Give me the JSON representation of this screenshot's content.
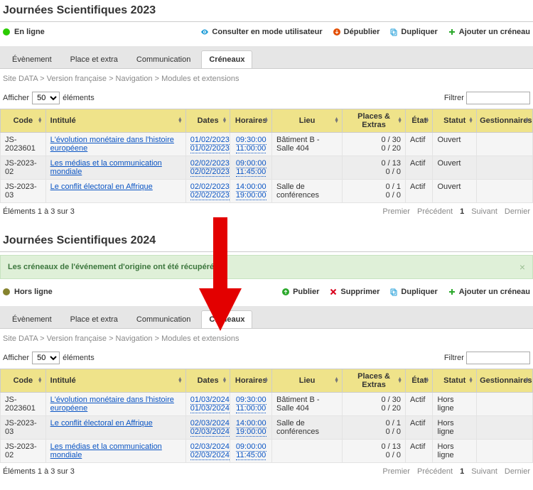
{
  "events": [
    {
      "title": "Journées Scientifiques 2023",
      "status": {
        "label": "En ligne",
        "online": true
      },
      "actions": [
        {
          "id": "view-mode",
          "label": "Consulter en mode utilisateur",
          "icon": "eye",
          "color": "#1f9dd8"
        },
        {
          "id": "unpublish",
          "label": "Dépublier",
          "icon": "arrowdown",
          "color": "#e34d00"
        },
        {
          "id": "duplicate",
          "label": "Dupliquer",
          "icon": "copy",
          "color": "#1f9dd8"
        },
        {
          "id": "add-slot",
          "label": "Ajouter un créneau",
          "icon": "plus",
          "color": "#2aa82a"
        }
      ],
      "notice": null,
      "tabs": [
        "Évènement",
        "Place et extra",
        "Communication",
        "Créneaux"
      ],
      "active_tab": 3,
      "breadcrumb": "Site DATA > Version française > Navigation > Modules et extensions",
      "display": {
        "prefix": "Afficher",
        "count": "50",
        "suffix": "éléments"
      },
      "filter_label": "Filtrer",
      "filter_value": "",
      "columns": [
        "Code",
        "Intitulé",
        "Dates",
        "Horaires",
        "Lieu",
        "Places & Extras",
        "État",
        "Statut",
        "Gestionnaires"
      ],
      "rows": [
        {
          "code": "JS-2023601",
          "title": "L'évolution monétaire dans l'histoire européene",
          "dates": [
            "01/02/2023",
            "01/02/2023"
          ],
          "times": [
            "09:30:00",
            "11:00:00"
          ],
          "lieu": "Bâtiment B - Salle 404",
          "pe": [
            "0 / 30",
            "0 / 20"
          ],
          "etat": "Actif",
          "statut": "Ouvert",
          "gest": ""
        },
        {
          "code": "JS-2023-02",
          "title": "Les médias et la communication mondiale",
          "dates": [
            "02/02/2023",
            "02/02/2023"
          ],
          "times": [
            "09:00:00",
            "11:45:00"
          ],
          "lieu": "",
          "pe": [
            "0 / 13",
            "0 / 0"
          ],
          "etat": "Actif",
          "statut": "Ouvert",
          "gest": ""
        },
        {
          "code": "JS-2023-03",
          "title": "Le conflit électoral en Affrique",
          "dates": [
            "02/02/2023",
            "02/02/2023"
          ],
          "times": [
            "14:00:00",
            "19:00:00"
          ],
          "lieu": "Salle de conférences",
          "pe": [
            "0 / 1",
            "0 / 0"
          ],
          "etat": "Actif",
          "statut": "Ouvert",
          "gest": ""
        }
      ],
      "footer_info": "Éléments 1 à 3 sur 3",
      "pager": [
        "Premier",
        "Précédent",
        "1",
        "Suivant",
        "Dernier"
      ]
    },
    {
      "title": "Journées Scientifiques 2024",
      "status": {
        "label": "Hors ligne",
        "online": false
      },
      "actions": [
        {
          "id": "publish",
          "label": "Publier",
          "icon": "arrowup",
          "color": "#2aa82a"
        },
        {
          "id": "delete",
          "label": "Supprimer",
          "icon": "cross",
          "color": "#d9001b"
        },
        {
          "id": "duplicate",
          "label": "Dupliquer",
          "icon": "copy",
          "color": "#1f9dd8"
        },
        {
          "id": "add-slot",
          "label": "Ajouter un créneau",
          "icon": "plus",
          "color": "#2aa82a"
        }
      ],
      "notice": "Les créneaux de l'événement d'origine ont été récupérés",
      "tabs": [
        "Évènement",
        "Place et extra",
        "Communication",
        "Créneaux"
      ],
      "active_tab": 3,
      "breadcrumb": "Site DATA > Version française > Navigation > Modules et extensions",
      "display": {
        "prefix": "Afficher",
        "count": "50",
        "suffix": "éléments"
      },
      "filter_label": "Filtrer",
      "filter_value": "",
      "columns": [
        "Code",
        "Intitulé",
        "Dates",
        "Horaires",
        "Lieu",
        "Places & Extras",
        "État",
        "Statut",
        "Gestionnaires"
      ],
      "rows": [
        {
          "code": "JS-2023601",
          "title": "L'évolution monétaire dans l'histoire européene",
          "dates": [
            "01/03/2024",
            "01/03/2024"
          ],
          "times": [
            "09:30:00",
            "11:00:00"
          ],
          "lieu": "Bâtiment B - Salle 404",
          "pe": [
            "0 / 30",
            "0 / 20"
          ],
          "etat": "Actif",
          "statut": "Hors ligne",
          "gest": ""
        },
        {
          "code": "JS-2023-03",
          "title": "Le conflit électoral en Affrique",
          "dates": [
            "02/03/2024",
            "02/03/2024"
          ],
          "times": [
            "14:00:00",
            "19:00:00"
          ],
          "lieu": "Salle de conférences",
          "pe": [
            "0 / 1",
            "0 / 0"
          ],
          "etat": "Actif",
          "statut": "Hors ligne",
          "gest": ""
        },
        {
          "code": "JS-2023-02",
          "title": "Les médias et la communication mondiale",
          "dates": [
            "02/03/2024",
            "02/03/2024"
          ],
          "times": [
            "09:00:00",
            "11:45:00"
          ],
          "lieu": "",
          "pe": [
            "0 / 13",
            "0 / 0"
          ],
          "etat": "Actif",
          "statut": "Hors ligne",
          "gest": ""
        }
      ],
      "footer_info": "Éléments 1 à 3 sur 3",
      "pager": [
        "Premier",
        "Précédent",
        "1",
        "Suivant",
        "Dernier"
      ]
    }
  ]
}
